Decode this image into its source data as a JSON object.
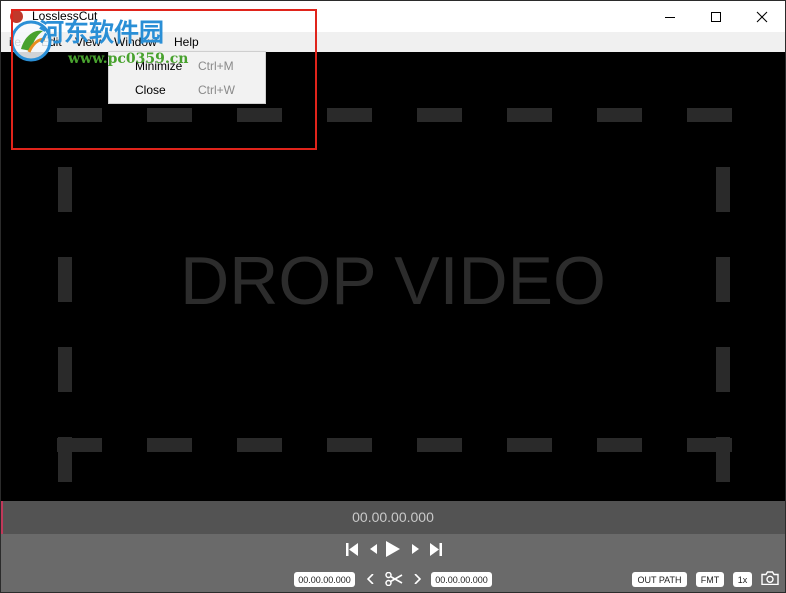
{
  "window": {
    "title": "LosslessCut",
    "icon": "app-icon"
  },
  "window_controls": {
    "minimize_icon": "minimize-icon",
    "maximize_icon": "maximize-icon",
    "close_icon": "close-icon"
  },
  "menubar": {
    "items": [
      {
        "label": "ile"
      },
      {
        "label": "Edit"
      },
      {
        "label": "View"
      },
      {
        "label": "Window"
      },
      {
        "label": "Help"
      }
    ]
  },
  "window_menu": {
    "items": [
      {
        "label": "Minimize",
        "shortcut": "Ctrl+M"
      },
      {
        "label": "Close",
        "shortcut": "Ctrl+W"
      }
    ]
  },
  "drop_zone": {
    "text": "DROP VIDEO"
  },
  "timeline": {
    "current_time": "00.00.00.000"
  },
  "controls": {
    "cut_start": "00.00.00.000",
    "cut_end": "00.00.00.000",
    "out_path_label": "OUT PATH",
    "format_label": "FMT",
    "speed_label": "1x",
    "icons": [
      "jump-to-start-icon",
      "step-back-icon",
      "play-icon",
      "step-forward-icon",
      "jump-to-end-icon",
      "set-cut-start-icon",
      "scissors-icon",
      "set-cut-end-icon",
      "camera-icon"
    ]
  },
  "watermark": {
    "title": "河东软件园",
    "url": "www.pc0359.cn"
  },
  "colors": {
    "highlight": "#e0241b",
    "timeline_marker": "#c0395a",
    "drop_dashes": "#2a2a2a",
    "watermark_blue": "#2a8fd6",
    "watermark_green": "#48a22e"
  }
}
